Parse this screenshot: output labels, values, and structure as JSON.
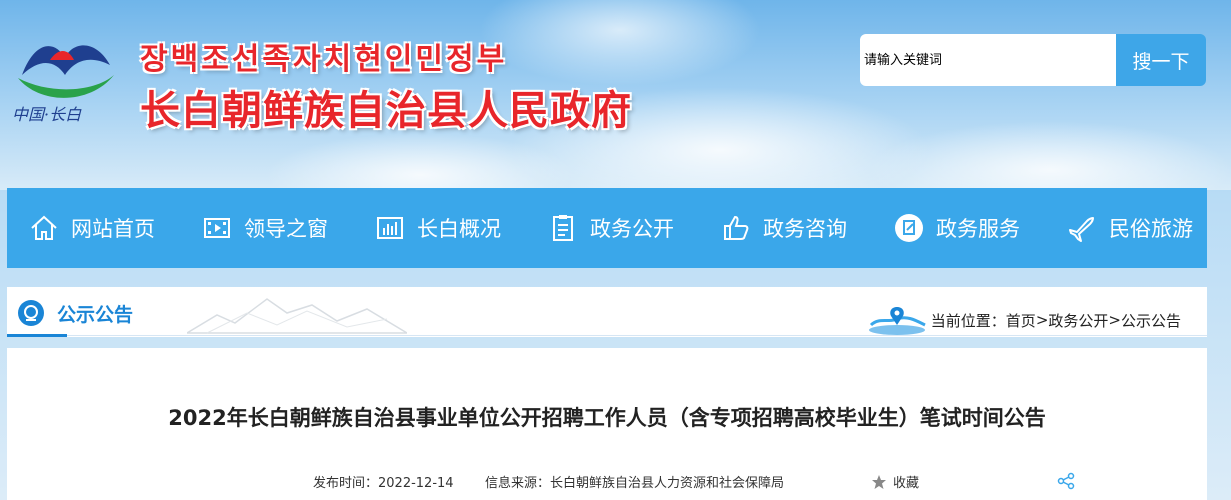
{
  "header": {
    "title_korean": "장백조선족자치현인민정부",
    "title_chinese": "长白朝鲜族自治县人民政府",
    "logo_text": "中国·长白"
  },
  "search": {
    "placeholder": "请输入关键词",
    "button_label": "搜一下"
  },
  "nav": {
    "items": [
      {
        "label": "网站首页",
        "icon": "home-icon"
      },
      {
        "label": "领导之窗",
        "icon": "film-icon"
      },
      {
        "label": "长白概况",
        "icon": "chart-icon"
      },
      {
        "label": "政务公开",
        "icon": "document-icon"
      },
      {
        "label": "政务咨询",
        "icon": "thumbs-up-icon"
      },
      {
        "label": "政务服务",
        "icon": "service-icon"
      },
      {
        "label": "民俗旅游",
        "icon": "plane-icon"
      }
    ]
  },
  "section": {
    "title": "公示公告",
    "breadcrumb_label": "当前位置：",
    "breadcrumb": [
      "首页",
      "政务公开",
      "公示公告"
    ],
    "separator": ">"
  },
  "article": {
    "title": "2022年长白朝鲜族自治县事业单位公开招聘工作人员（含专项招聘高校毕业生）笔试时间公告",
    "publish_label": "发布时间：",
    "publish_date": "2022-12-14",
    "source_label": "信息来源：",
    "source": "长白朝鲜族自治县人力资源和社会保障局",
    "favorite_label": "收藏"
  },
  "colors": {
    "nav_bg": "#3aa7ea",
    "title_red": "#e8262b",
    "section_blue": "#1a85d6",
    "search_button": "#3ea6e8"
  }
}
